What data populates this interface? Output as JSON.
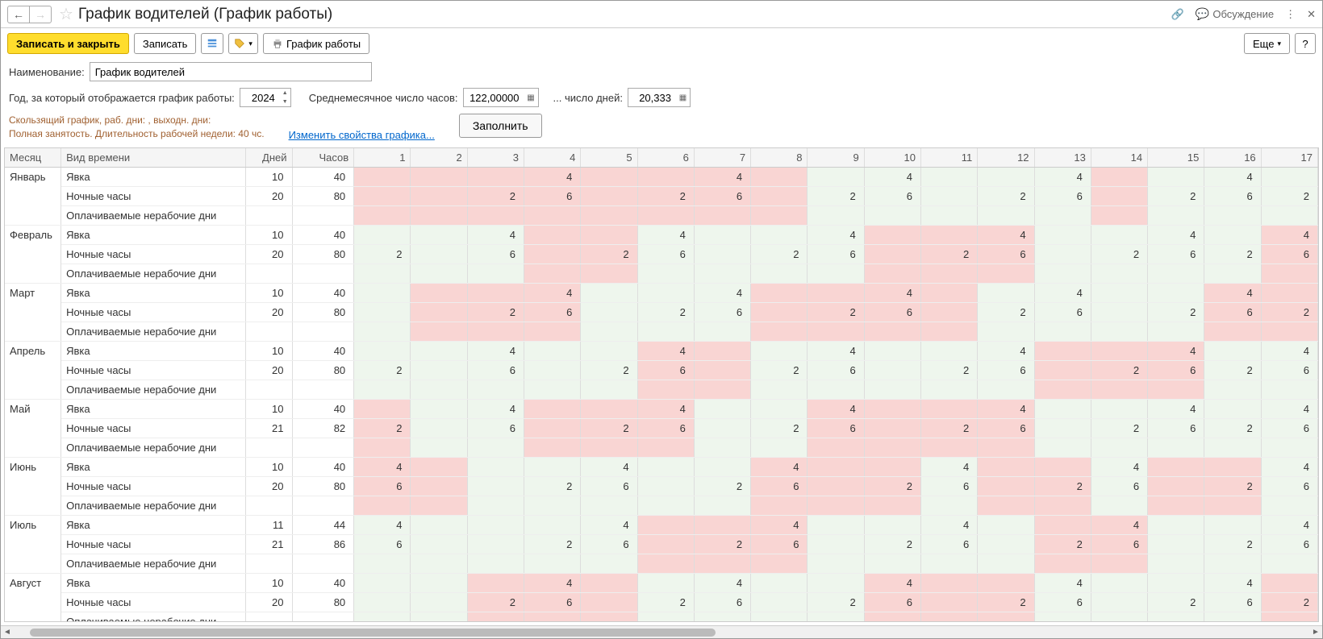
{
  "title": "График водителей (График работы)",
  "toolbar": {
    "save_close": "Записать и закрыть",
    "save": "Записать",
    "print_schedule": "График работы",
    "more": "Еще",
    "discuss": "Обсуждение"
  },
  "form": {
    "name_label": "Наименование:",
    "name_value": "График водителей",
    "year_label": "Год, за который отображается график работы:",
    "year_value": "2024",
    "avg_hours_label": "Среднемесячное число часов:",
    "avg_hours_value": "122,00000",
    "avg_days_label": "... число дней:",
    "avg_days_value": "20,333"
  },
  "info": {
    "line1": "Скользящий график, раб. дни: , выходн. дни:",
    "line2": "Полная занятость. Длительность рабочей недели: 40 чс.",
    "change_link": "Изменить свойства графика...",
    "fill_btn": "Заполнить"
  },
  "grid": {
    "headers": {
      "month": "Месяц",
      "type": "Вид времени",
      "days": "Дней",
      "hours": "Часов"
    },
    "day_cols": [
      "1",
      "2",
      "3",
      "4",
      "5",
      "6",
      "7",
      "8",
      "9",
      "10",
      "11",
      "12",
      "13",
      "14",
      "15",
      "16",
      "17"
    ],
    "row_types": {
      "attendance": "Явка",
      "night": "Ночные часы",
      "paid_off": "Оплачиваемые нерабочие дни"
    },
    "months": [
      {
        "name": "Январь",
        "days_att": "10",
        "hours_att": "40",
        "days_night": "20",
        "hours_night": "80",
        "cells_att": {
          "4": "4",
          "7": "4",
          "10": "4",
          "13": "4",
          "16": "4"
        },
        "cells_night": {
          "3": "2",
          "4": "6",
          "6": "2",
          "7": "6",
          "9": "2",
          "10": "6",
          "12": "2",
          "13": "6",
          "15": "2",
          "16": "6",
          "17": "2"
        },
        "pink": [
          1,
          2,
          3,
          4,
          5,
          6,
          7,
          8,
          14
        ],
        "green": [
          9,
          10,
          11,
          12,
          13,
          15,
          16,
          17
        ]
      },
      {
        "name": "Февраль",
        "days_att": "10",
        "hours_att": "40",
        "days_night": "20",
        "hours_night": "80",
        "cells_att": {
          "3": "4",
          "6": "4",
          "9": "4",
          "12": "4",
          "15": "4",
          "17": "4"
        },
        "cells_night": {
          "1": "2",
          "3": "6",
          "5": "2",
          "6": "6",
          "8": "2",
          "9": "6",
          "11": "2",
          "12": "6",
          "14": "2",
          "15": "6",
          "16": "2",
          "17": "6"
        },
        "pink": [
          4,
          5,
          10,
          11,
          12,
          17
        ],
        "green": [
          1,
          2,
          3,
          6,
          7,
          8,
          9,
          13,
          14,
          15,
          16
        ]
      },
      {
        "name": "Март",
        "days_att": "10",
        "hours_att": "40",
        "days_night": "20",
        "hours_night": "80",
        "cells_att": {
          "4": "4",
          "7": "4",
          "10": "4",
          "13": "4",
          "16": "4"
        },
        "cells_night": {
          "3": "2",
          "4": "6",
          "6": "2",
          "7": "6",
          "9": "2",
          "10": "6",
          "12": "2",
          "13": "6",
          "15": "2",
          "16": "6",
          "17": "2"
        },
        "pink": [
          2,
          3,
          4,
          8,
          9,
          10,
          11,
          16,
          17
        ],
        "green": [
          1,
          5,
          6,
          7,
          12,
          13,
          14,
          15
        ]
      },
      {
        "name": "Апрель",
        "days_att": "10",
        "hours_att": "40",
        "days_night": "20",
        "hours_night": "80",
        "cells_att": {
          "3": "4",
          "6": "4",
          "9": "4",
          "12": "4",
          "15": "4",
          "17": "4"
        },
        "cells_night": {
          "1": "2",
          "3": "6",
          "5": "2",
          "6": "6",
          "8": "2",
          "9": "6",
          "11": "2",
          "12": "6",
          "14": "2",
          "15": "6",
          "16": "2",
          "17": "6"
        },
        "pink": [
          6,
          7,
          13,
          14,
          15
        ],
        "green": [
          1,
          2,
          3,
          4,
          5,
          8,
          9,
          10,
          11,
          12,
          16,
          17
        ]
      },
      {
        "name": "Май",
        "days_att": "10",
        "hours_att": "40",
        "days_night": "21",
        "hours_night": "82",
        "cells_att": {
          "3": "4",
          "6": "4",
          "9": "4",
          "12": "4",
          "15": "4",
          "17": "4"
        },
        "cells_night": {
          "1": "2",
          "3": "6",
          "5": "2",
          "6": "6",
          "8": "2",
          "9": "6",
          "11": "2",
          "12": "6",
          "14": "2",
          "15": "6",
          "16": "2",
          "17": "6"
        },
        "pink": [
          1,
          4,
          5,
          6,
          9,
          10,
          11,
          12
        ],
        "green": [
          2,
          3,
          7,
          8,
          13,
          14,
          15,
          16,
          17
        ]
      },
      {
        "name": "Июнь",
        "days_att": "10",
        "hours_att": "40",
        "days_night": "20",
        "hours_night": "80",
        "cells_att": {
          "1": "4",
          "5": "4",
          "8": "4",
          "11": "4",
          "14": "4",
          "17": "4"
        },
        "cells_night": {
          "1": "6",
          "4": "2",
          "5": "6",
          "7": "2",
          "8": "6",
          "10": "2",
          "11": "6",
          "13": "2",
          "14": "6",
          "16": "2",
          "17": "6"
        },
        "pink": [
          1,
          2,
          8,
          9,
          10,
          12,
          13,
          15,
          16
        ],
        "green": [
          3,
          4,
          5,
          6,
          7,
          11,
          14,
          17
        ]
      },
      {
        "name": "Июль",
        "days_att": "11",
        "hours_att": "44",
        "days_night": "21",
        "hours_night": "86",
        "cells_att": {
          "1": "4",
          "5": "4",
          "8": "4",
          "11": "4",
          "14": "4",
          "17": "4"
        },
        "cells_night": {
          "1": "6",
          "4": "2",
          "5": "6",
          "7": "2",
          "8": "6",
          "10": "2",
          "11": "6",
          "13": "2",
          "14": "6",
          "16": "2",
          "17": "6"
        },
        "pink": [
          6,
          7,
          8,
          13,
          14
        ],
        "green": [
          1,
          2,
          3,
          4,
          5,
          9,
          10,
          11,
          12,
          15,
          16,
          17
        ]
      },
      {
        "name": "Август",
        "days_att": "10",
        "hours_att": "40",
        "days_night": "20",
        "hours_night": "80",
        "cells_att": {
          "4": "4",
          "7": "4",
          "10": "4",
          "13": "4",
          "16": "4"
        },
        "cells_night": {
          "3": "2",
          "4": "6",
          "6": "2",
          "7": "6",
          "9": "2",
          "10": "6",
          "12": "2",
          "13": "6",
          "15": "2",
          "16": "6",
          "17": "2"
        },
        "pink": [
          3,
          4,
          5,
          10,
          11,
          12,
          17
        ],
        "green": [
          1,
          2,
          6,
          7,
          8,
          9,
          13,
          14,
          15,
          16
        ]
      }
    ]
  }
}
